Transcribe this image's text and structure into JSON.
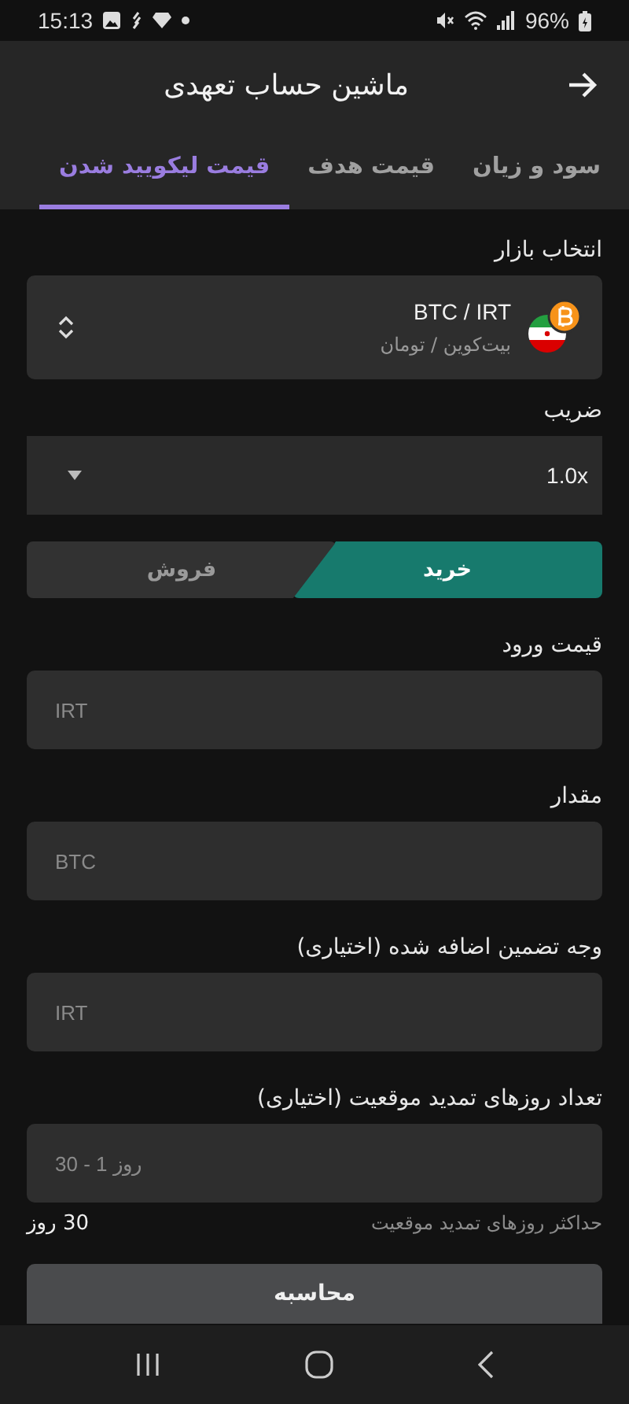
{
  "status_bar": {
    "time": "15:13",
    "battery": "96%"
  },
  "header": {
    "title": "ماشین حساب تعهدی"
  },
  "tabs": [
    {
      "label": "سود و زیان",
      "selected": false
    },
    {
      "label": "قیمت هدف",
      "selected": false
    },
    {
      "label": "قیمت لیکویید شدن",
      "selected": true
    }
  ],
  "market": {
    "label": "انتخاب بازار",
    "pair": "BTC / IRT",
    "name": "بیت‌کوین / تومان"
  },
  "multiplier": {
    "label": "ضریب",
    "value": "1.0x"
  },
  "side": [
    {
      "label": "خرید",
      "selected": true
    },
    {
      "label": "فروش",
      "selected": false
    }
  ],
  "fields": [
    {
      "label": "قیمت ورود",
      "placeholder": "IRT"
    },
    {
      "label": "مقدار",
      "placeholder": "BTC"
    },
    {
      "label": "وجه تضمین اضافه شده (اختیاری)",
      "placeholder": "IRT"
    },
    {
      "label": "تعداد روزهای تمدید موقعیت (اختیاری)",
      "placeholder": "30 - 1 روز"
    }
  ],
  "hint": {
    "text": "حداکثر روزهای تمدید موقعیت",
    "value": "30 روز"
  },
  "submit": {
    "label": "محاسبه"
  }
}
